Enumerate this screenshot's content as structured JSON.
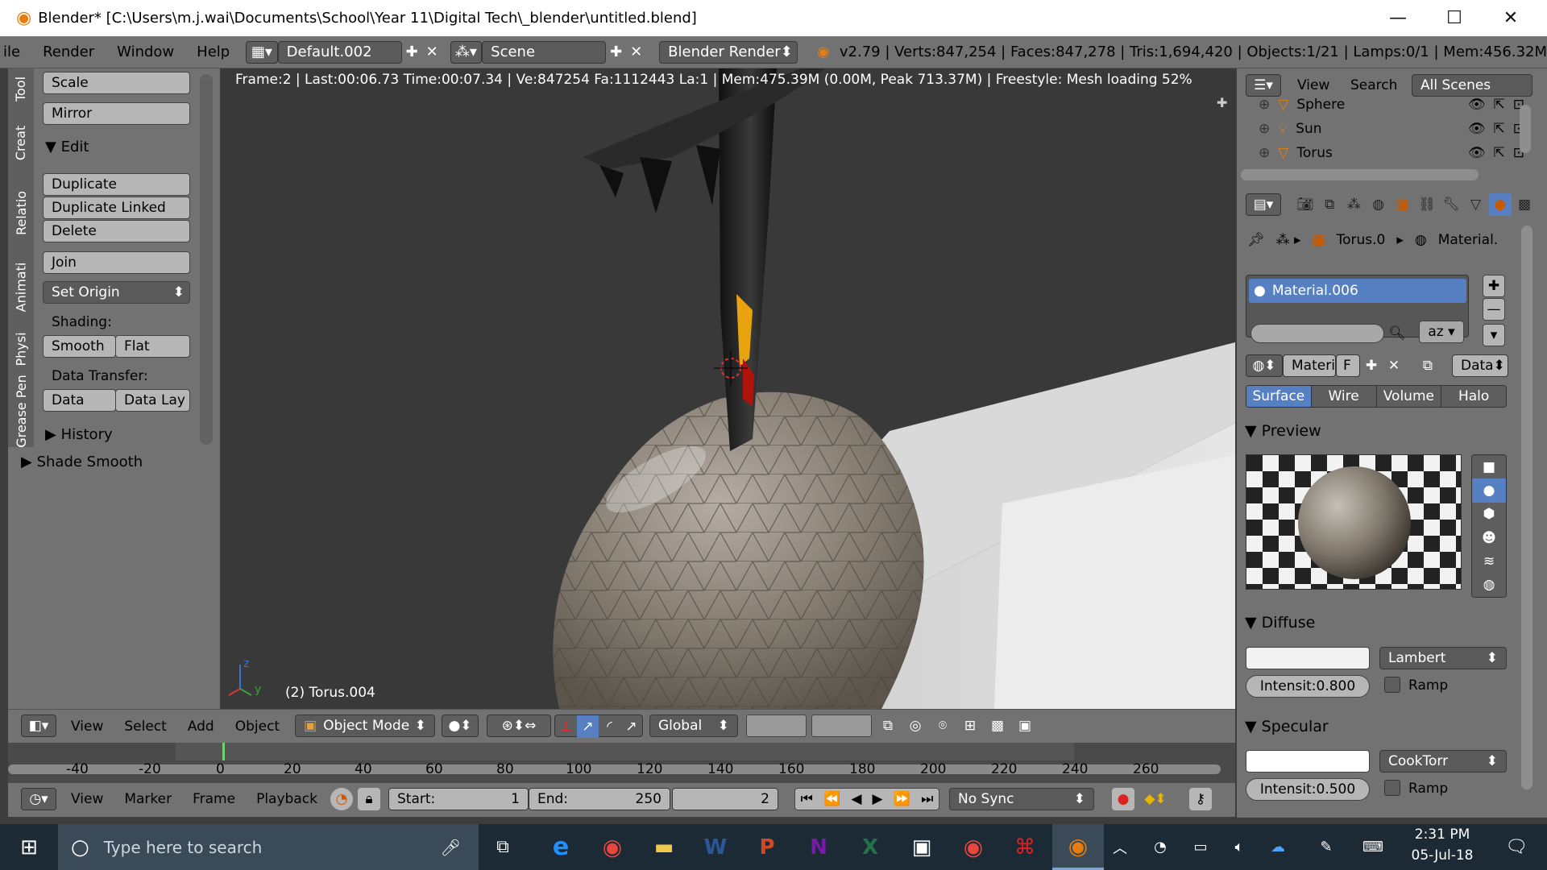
{
  "window": {
    "title": "Blender* [C:\\Users\\m.j.wai\\Documents\\School\\Year 11\\Digital Tech\\_blender\\untitled.blend]"
  },
  "info_header": {
    "menus": [
      "File",
      "Render",
      "Window",
      "Help"
    ],
    "layout_field": "Default.002",
    "scene_field": "Scene",
    "engine": "Blender Render",
    "stats": "v2.79 | Verts:847,254 | Faces:847,278 | Tris:1,694,420 | Objects:1/21 | Lamps:0/1 | Mem:456.32M"
  },
  "tool_tabs": [
    "Tool",
    "Creat",
    "Relatio",
    "Animati",
    "Physi",
    "Grease Pen"
  ],
  "tool_shelf": {
    "scale": "Scale",
    "mirror": "Mirror",
    "edit_header": "Edit",
    "duplicate": "Duplicate",
    "duplicate_linked": "Duplicate Linked",
    "delete": "Delete",
    "join": "Join",
    "set_origin": "Set Origin",
    "shading_label": "Shading:",
    "smooth": "Smooth",
    "flat": "Flat",
    "data_transfer_label": "Data Transfer:",
    "data": "Data",
    "data_lay": "Data Lay",
    "history": "History",
    "last_op": "Shade Smooth"
  },
  "viewport": {
    "render_info": "Frame:2 | Last:00:06.73 Time:00:07.34 | Ve:847254 Fa:1112443 La:1 | Mem:475.39M (0.00M, Peak 713.37M) | Freestyle: Mesh loading 52%",
    "object_label": "(2) Torus.004",
    "axis_z": "z",
    "axis_y": "y"
  },
  "view_header": {
    "menus": [
      "View",
      "Select",
      "Add",
      "Object"
    ],
    "mode": "Object Mode",
    "orientation": "Global"
  },
  "timeline": {
    "ticks": [
      "-40",
      "-20",
      "0",
      "20",
      "40",
      "60",
      "80",
      "100",
      "120",
      "140",
      "160",
      "180",
      "200",
      "220",
      "240",
      "260"
    ],
    "menus": [
      "View",
      "Marker",
      "Frame",
      "Playback"
    ],
    "start_label": "Start:",
    "start_value": "1",
    "end_label": "End:",
    "end_value": "250",
    "current_frame": "2",
    "sync": "No Sync"
  },
  "outliner": {
    "menus": [
      "View",
      "Search"
    ],
    "scenes": "All Scenes",
    "items": [
      {
        "name": "Sphere",
        "icon": "mesh-icon"
      },
      {
        "name": "Sun",
        "icon": "lamp-icon"
      },
      {
        "name": "Torus",
        "icon": "mesh-icon"
      }
    ]
  },
  "properties": {
    "breadcrumb_object": "Torus.0",
    "breadcrumb_material": "Material.",
    "slot_name": "Material.006",
    "mat_field": "Materi",
    "mat_f": "F",
    "data_dropdown": "Data",
    "tabs": [
      "Surface",
      "Wire",
      "Volume",
      "Halo"
    ],
    "preview_header": "Preview",
    "diffuse_header": "Diffuse",
    "diffuse_shader": "Lambert",
    "diffuse_intensity_label": "Intensit:",
    "diffuse_intensity": "0.800",
    "ramp": "Ramp",
    "specular_header": "Specular",
    "specular_shader": "CookTorr",
    "specular_intensity_label": "Intensit:",
    "specular_intensity": "0.500"
  },
  "taskbar": {
    "search_placeholder": "Type here to search",
    "time": "2:31 PM",
    "date": "05-Jul-18"
  },
  "colors": {
    "panel_bg": "#727272",
    "viewport_bg": "#393939",
    "selected_blue": "#5680c2",
    "taskbar_bg": "#1c2a36"
  }
}
